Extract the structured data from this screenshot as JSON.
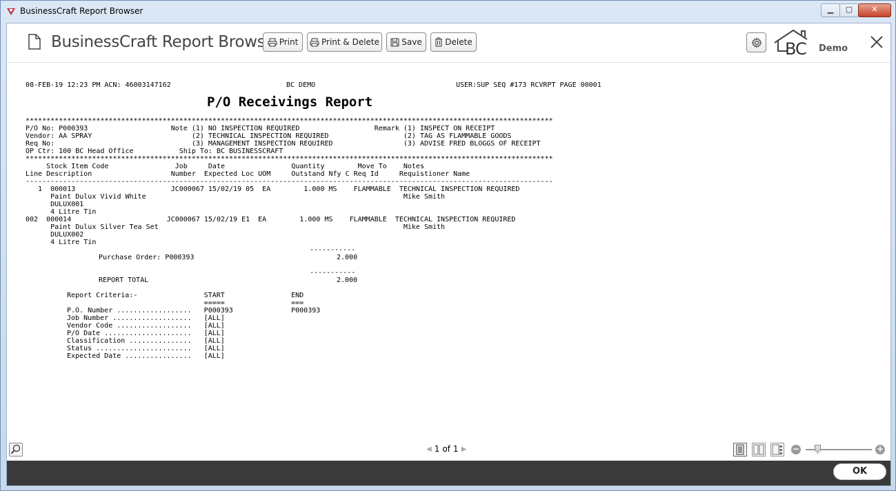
{
  "window": {
    "title": "BusinessCraft Report Browser",
    "minimize": "▁",
    "maximize": "▢",
    "close": "✕"
  },
  "header": {
    "title": "BusinessCraft Report Browser",
    "buttons": {
      "print": "Print",
      "print_delete": "Print & Delete",
      "save": "Save",
      "delete": "Delete"
    },
    "logo_text": "BC",
    "logo_sub": "Demo"
  },
  "report": {
    "line_header_left": "08-FEB-19 12:23 PM ACN: 46003147162",
    "line_header_mid": "BC DEMO",
    "line_header_right": "USER:SUP SEQ #173 RCVRPT PAGE 00001",
    "title": "P/O Receivings Report",
    "rule_star": "*******************************************************************************************************************************",
    "info_line1": "P/O No: P000393                    Note (1) NO INSPECTION REQUIRED                  Remark (1) INSPECT ON RECEIPT",
    "info_line2": "Vendor: AA SPRAY                        (2) TECHNICAL INSPECTION REQUIRED                  (2) TAG AS FLAMMABLE GOODS",
    "info_line3": "Req No:                                 (3) MANAGEMENT INSPECTION REQUIRED                 (3) ADVISE FRED BLOGGS OF RECEIPT",
    "info_line4": "OP Ctr: 100 BC Head Office           Ship To: BC BUSINESSCRAFT",
    "col_head1": "     Stock Item Code                Job     Date                Quantity        Move To    Notes",
    "col_head2": "Line Description                   Number  Expected Loc UOM     Outstand Nfy C Req Id     Requistioner Name",
    "rule_dash": "-------------------------------------------------------------------------------------------------------------------------------",
    "detail": [
      "   1  000013                       JC000067 15/02/19 05  EA        1.000 MS    FLAMMABLE  TECHNICAL INSPECTION REQUIRED",
      "      Paint Dulux Vivid White                                                              Mike Smith",
      "      DULUX001",
      "      4 Litre Tin",
      "002  000014                       JC000067 15/02/19 E1  EA        1.000 MS    FLAMMABLE  TECHNICAL INSPECTION REQUIRED",
      "      Paint Dulux Silver Tea Set                                                           Mike Smith",
      "      DULUX002",
      "      4 Litre Tin"
    ],
    "subtotal_rule": "-----------",
    "po_total_label": "Purchase Order: P000393",
    "po_total_value": "2.000",
    "report_total_label": "REPORT TOTAL",
    "report_total_value": "2.000",
    "criteria": [
      "Report Criteria:-                START                END",
      "                                 =====                ===",
      "P.O. Number ..................   P000393              P000393",
      "Job Number ...................   [ALL]",
      "Vendor Code ..................   [ALL]",
      "P/O Date .....................   [ALL]",
      "Classification ...............   [ALL]",
      "Status .......................   [ALL]",
      "Expected Date ................   [ALL]"
    ]
  },
  "footer": {
    "page_current": "1",
    "page_of": "of",
    "page_total": "1",
    "ok_label": "OK"
  }
}
